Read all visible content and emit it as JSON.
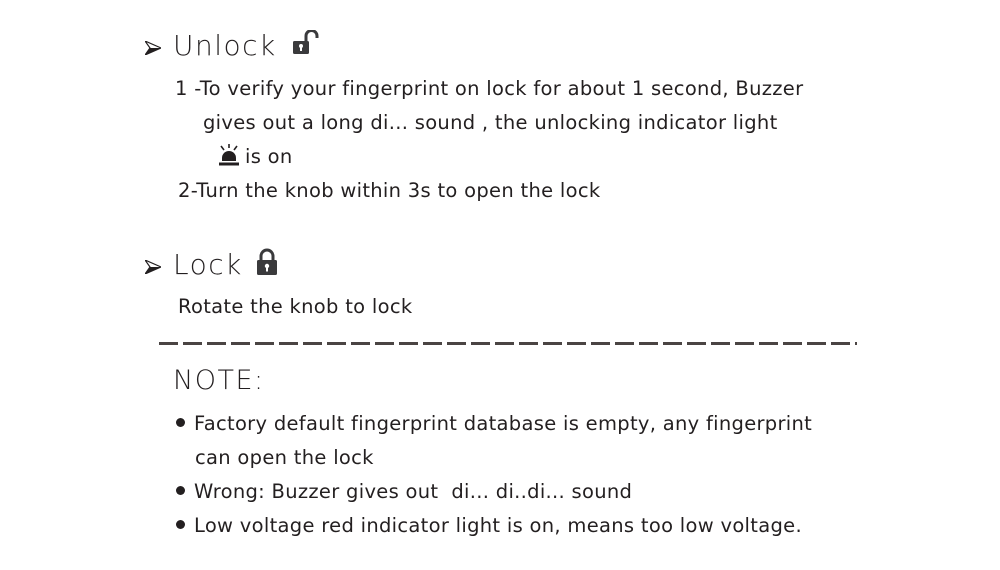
{
  "unlock": {
    "title": "Unlock",
    "icon": "unlocked-padlock-icon",
    "steps": [
      {
        "number": "1 -",
        "line1": "To verify your fingerprint on lock for about 1 second, Buzzer",
        "line2": "gives out a long di... sound , the unlocking indicator light",
        "line3_icon": "indicator-light-icon",
        "line3": "is on"
      },
      {
        "number": "2-",
        "line1": "Turn the knob within 3s to open the lock"
      }
    ]
  },
  "lock": {
    "title": "Lock",
    "icon": "locked-padlock-icon",
    "text": "Rotate the knob to lock"
  },
  "note": {
    "title": "NOTE:",
    "items": [
      {
        "line1": "Factory default fingerprint database is empty, any fingerprint",
        "line2": "can open the lock"
      },
      {
        "line1": "Wrong: Buzzer gives out  di... di..di... sound"
      },
      {
        "line1": "Low voltage red indicator light is on, means too low voltage."
      }
    ]
  }
}
